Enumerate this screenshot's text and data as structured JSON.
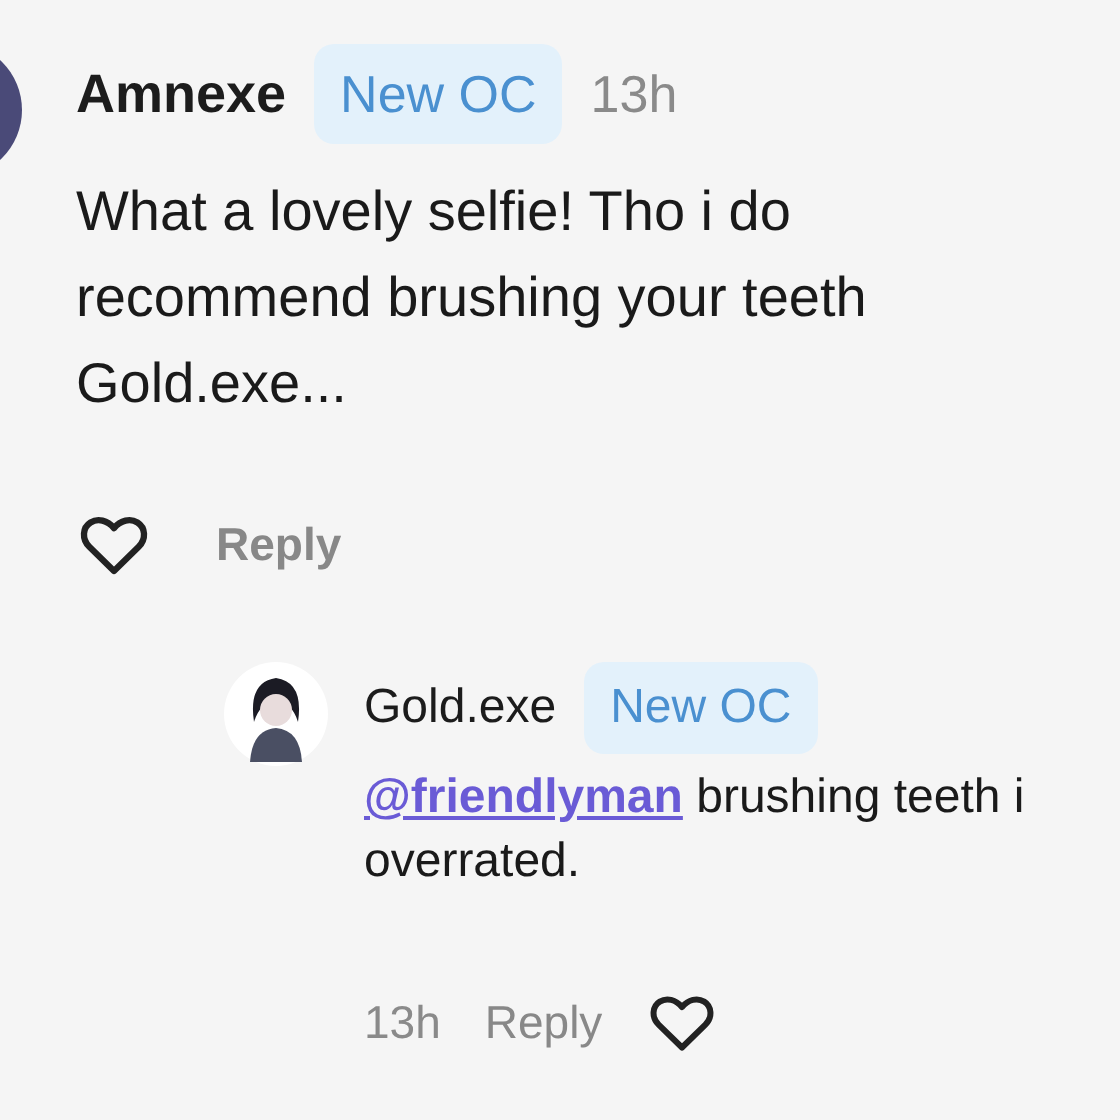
{
  "comment": {
    "author": "Amnexe",
    "badge": "New OC",
    "time": "13h",
    "text_lines": [
      "What a lovely selfie! Tho i do",
      "recommend brushing your teeth",
      "Gold.exe..."
    ],
    "liked": false,
    "reply_label": "Reply"
  },
  "reply": {
    "author": "Gold.exe",
    "badge": "New OC",
    "mention": "@friendlyman",
    "text_lines": [
      "brushing teeth i",
      "overrated."
    ],
    "time": "13h",
    "reply_label": "Reply",
    "liked": false
  }
}
